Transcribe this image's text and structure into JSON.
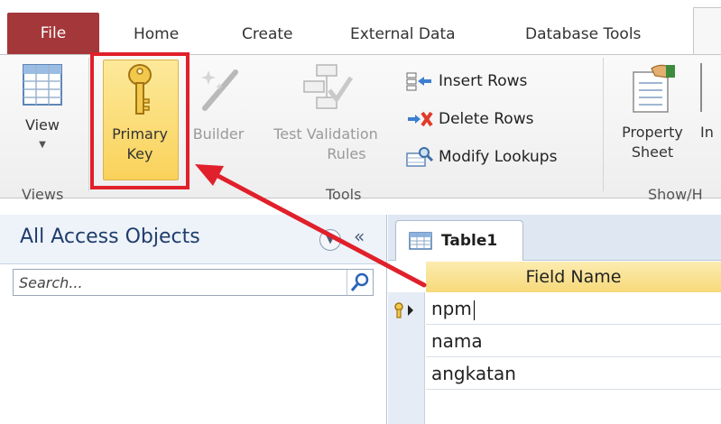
{
  "tabs": {
    "file": "File",
    "home": "Home",
    "create": "Create",
    "external": "External Data",
    "dbtools": "Database Tools"
  },
  "ribbon": {
    "view_label": "View",
    "primary_key_line1": "Primary",
    "primary_key_line2": "Key",
    "builder_label": "Builder",
    "test_validation_line1": "Test Validation",
    "test_validation_line2": "Rules",
    "insert_rows": "Insert Rows",
    "delete_rows": "Delete Rows",
    "modify_lookups": "Modify Lookups",
    "property_line1": "Property",
    "property_line2": "Sheet",
    "partial_in": "In",
    "groups": {
      "views": "Views",
      "tools": "Tools",
      "showhide": "Show/H"
    }
  },
  "nav": {
    "title": "All Access Objects",
    "collapse": "«",
    "search_placeholder": "Search..."
  },
  "doc": {
    "tab_label": "Table1",
    "column_header": "Field Name",
    "rows": [
      "npm",
      "nama",
      "angkatan"
    ]
  },
  "colors": {
    "file_tab": "#a4373a",
    "highlight_box": "#e0202a",
    "arrow": "#e0202a"
  },
  "icons": {
    "view": "datasheet-view-icon",
    "primary_key": "key-icon",
    "builder": "builder-wand-icon",
    "test_validation": "validation-icon",
    "insert_rows": "insert-rows-icon",
    "delete_rows": "delete-rows-icon",
    "modify_lookups": "lookup-icon",
    "property_sheet": "property-sheet-icon",
    "search": "search-icon",
    "table": "table-icon"
  }
}
